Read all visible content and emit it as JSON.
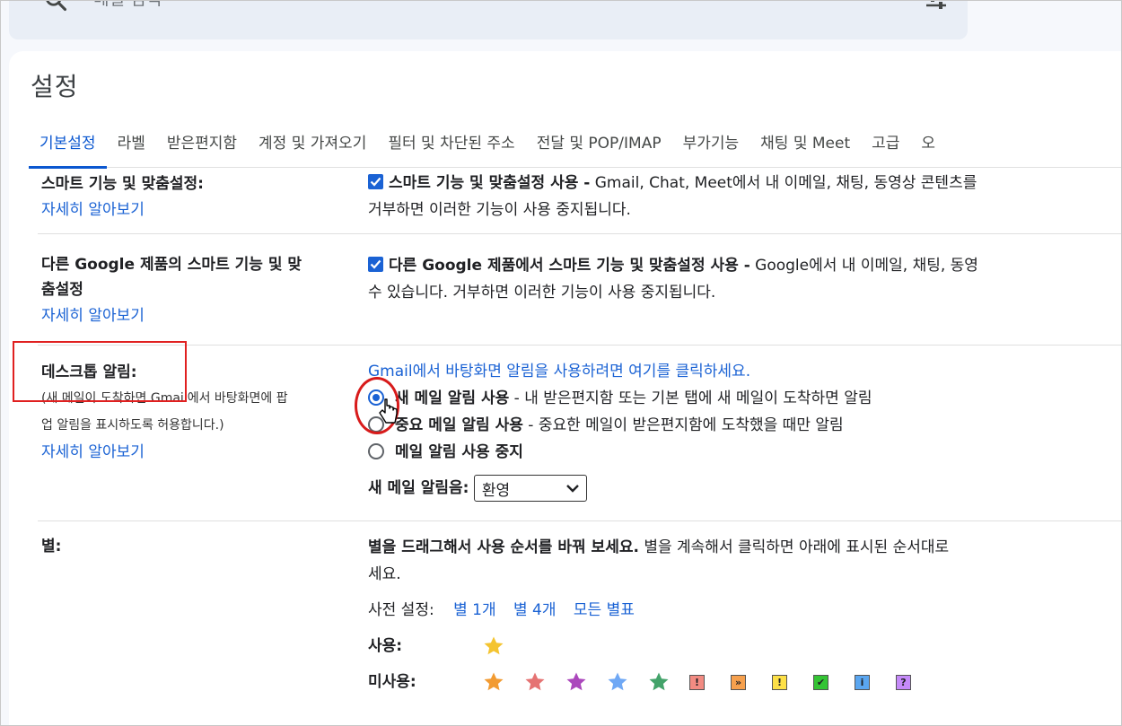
{
  "search": {
    "placeholder": "메일 검색"
  },
  "page_title": "설정",
  "tabs": [
    {
      "label": "기본설정",
      "active": true
    },
    {
      "label": "라벨"
    },
    {
      "label": "받은편지함"
    },
    {
      "label": "계정 및 가져오기"
    },
    {
      "label": "필터 및 차단된 주소"
    },
    {
      "label": "전달 및 POP/IMAP"
    },
    {
      "label": "부가기능"
    },
    {
      "label": "채팅 및 Meet"
    },
    {
      "label": "고급"
    },
    {
      "label": "오"
    }
  ],
  "smart_features": {
    "label": "스마트 기능 및 맞춤설정:",
    "help": "자세히 알아보기",
    "checkbox_label": "스마트 기능 및 맞춤설정 사용 -",
    "description_1": " Gmail, Chat, Meet에서 내 이메일, 채팅, 동영상 콘텐츠를",
    "description_2": "거부하면 이러한 기능이 사용 중지됩니다."
  },
  "google_products": {
    "label_1": "다른 Google 제품의 스마트 기능 및 맞",
    "label_2": "춤설정",
    "help": "자세히 알아보기",
    "checkbox_label": "다른 Google 제품에서 스마트 기능 및 맞춤설정 사용 -",
    "description_1": " Google에서 내 이메일, 채팅, 동영",
    "description_2": "수 있습니다. 거부하면 이러한 기능이 사용 중지됩니다."
  },
  "desktop_notifications": {
    "label": "데스크톱 알림:",
    "sub_1": "(새 메일이 도착하면 Gmail에서 바탕화면에 팝",
    "sub_2": "업 알림을 표시하도록 허용합니다.)",
    "help": "자세히 알아보기",
    "enable_link": "Gmail에서 바탕화면 알림을 사용하려면 여기를 클릭하세요.",
    "options": [
      {
        "title": "새 메일 알림 사용",
        "desc": " - 내 받은편지함 또는 기본 탭에 새 메일이 도착하면 알림",
        "selected": true
      },
      {
        "title": "중요 메일 알림 사용",
        "desc": " - 중요한 메일이 받은편지함에 도착했을 때만 알림",
        "selected": false
      },
      {
        "title": "메일 알림 사용 중지",
        "desc": "",
        "selected": false
      }
    ],
    "sound_label": "새 메일 알림음:",
    "sound_value": "환영"
  },
  "stars": {
    "label": "별:",
    "instruction_bold": "별을 드래그해서 사용 순서를 바꿔 보세요.",
    "instruction_rest": "  별을 계속해서 클릭하면 아래에 표시된 순서대로",
    "instruction_2": "세요.",
    "presets_label": "사전 설정:",
    "presets": [
      "별 1개",
      "별 4개",
      "모든 별표"
    ],
    "in_use_label": "사용:",
    "not_in_use_label": "미사용:",
    "in_use": [
      {
        "icon": "yellow-star-icon",
        "color": "#f4c430"
      }
    ],
    "not_in_use": [
      {
        "icon": "orange-star-icon",
        "color": "#f29b32",
        "kind": "star"
      },
      {
        "icon": "red-star-icon",
        "color": "#e57373",
        "kind": "star"
      },
      {
        "icon": "purple-star-icon",
        "color": "#ab47bc",
        "kind": "star"
      },
      {
        "icon": "blue-star-icon",
        "color": "#6fa8f5",
        "kind": "star"
      },
      {
        "icon": "green-star-icon",
        "color": "#43a36a",
        "kind": "star"
      },
      {
        "icon": "red-bang-icon",
        "color": "#f28b82",
        "kind": "badge",
        "glyph": "!"
      },
      {
        "icon": "orange-guillemet-icon",
        "color": "#f6a04d",
        "kind": "badge",
        "glyph": "»"
      },
      {
        "icon": "yellow-bang-icon",
        "color": "#fde047",
        "kind": "badge",
        "glyph": "!"
      },
      {
        "icon": "green-check-icon",
        "color": "#34c434",
        "kind": "badge",
        "glyph": "✔"
      },
      {
        "icon": "blue-info-icon",
        "color": "#5aa6f0",
        "kind": "badge",
        "glyph": "i"
      },
      {
        "icon": "purple-question-icon",
        "color": "#c58af9",
        "kind": "badge",
        "glyph": "?"
      }
    ]
  }
}
